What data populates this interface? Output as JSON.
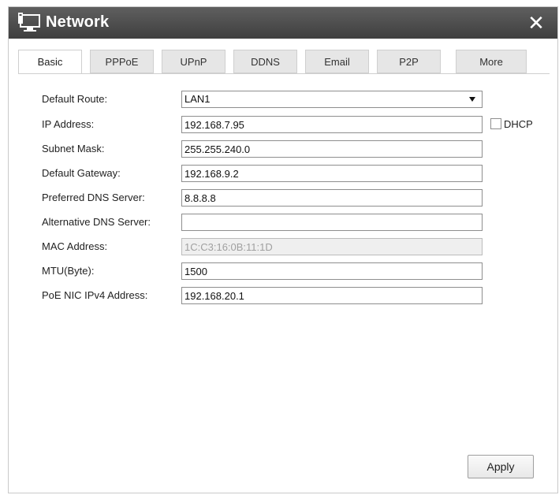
{
  "window": {
    "title": "Network",
    "close_icon": "close-icon",
    "title_icon": "network-computer-icon"
  },
  "tabs": [
    {
      "label": "Basic",
      "active": true
    },
    {
      "label": "PPPoE",
      "active": false
    },
    {
      "label": "UPnP",
      "active": false
    },
    {
      "label": "DDNS",
      "active": false
    },
    {
      "label": "Email",
      "active": false
    },
    {
      "label": "P2P",
      "active": false
    },
    {
      "label": "More",
      "active": false
    }
  ],
  "form": {
    "default_route": {
      "label": "Default Route:",
      "value": "LAN1"
    },
    "ip_address": {
      "label": "IP Address:",
      "value": "192.168.7.95"
    },
    "dhcp": {
      "label": "DHCP",
      "checked": false
    },
    "subnet_mask": {
      "label": "Subnet Mask:",
      "value": "255.255.240.0"
    },
    "default_gateway": {
      "label": "Default Gateway:",
      "value": "192.168.9.2"
    },
    "preferred_dns": {
      "label": "Preferred DNS Server:",
      "value": "8.8.8.8"
    },
    "alternative_dns": {
      "label": "Alternative DNS Server:",
      "value": ""
    },
    "mac_address": {
      "label": "MAC Address:",
      "value": "1C:C3:16:0B:11:1D"
    },
    "mtu": {
      "label": "MTU(Byte):",
      "value": "1500"
    },
    "poe_nic_ipv4": {
      "label": "PoE NIC IPv4 Address:",
      "value": "192.168.20.1"
    }
  },
  "buttons": {
    "apply": "Apply"
  },
  "colors": {
    "titlebar": "#4a4a4a",
    "tab_inactive": "#e6e6e6",
    "border": "#8e8e8e"
  }
}
